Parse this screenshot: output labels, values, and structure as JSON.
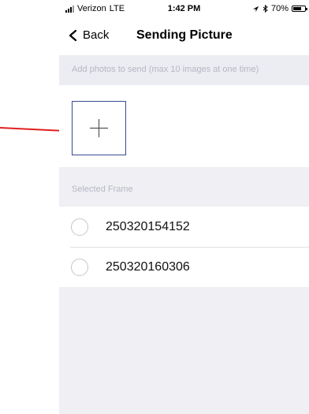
{
  "status_bar": {
    "carrier": "Verizon",
    "network": "LTE",
    "time": "1:42 PM",
    "battery": "70%",
    "icons": [
      "signal-icon",
      "location-icon",
      "bluetooth-icon",
      "battery-icon"
    ]
  },
  "nav": {
    "back_label": "Back",
    "title": "Sending Picture"
  },
  "hint": {
    "text": "Add photos to send (max 10 images at one time)"
  },
  "add_button": {
    "icon": "plus-icon"
  },
  "section": {
    "title": "Selected Frame"
  },
  "frames": [
    {
      "label": "250320154152"
    },
    {
      "label": "250320160306"
    }
  ],
  "colors": {
    "accent_border": "#3a4a96",
    "annotation_arrow": "#e02020",
    "background": "#efeff4"
  }
}
